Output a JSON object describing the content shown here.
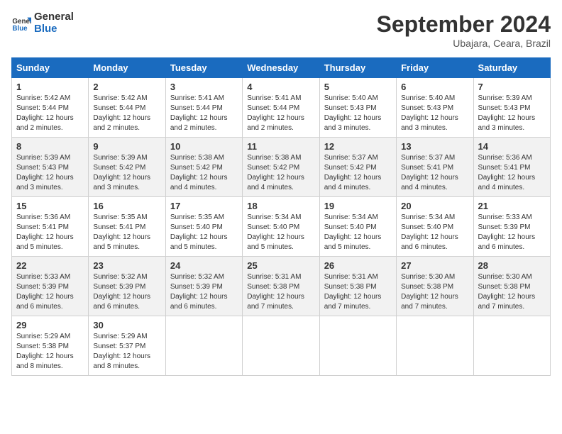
{
  "header": {
    "logo_line1": "General",
    "logo_line2": "Blue",
    "month_title": "September 2024",
    "location": "Ubajara, Ceara, Brazil"
  },
  "days_of_week": [
    "Sunday",
    "Monday",
    "Tuesday",
    "Wednesday",
    "Thursday",
    "Friday",
    "Saturday"
  ],
  "weeks": [
    [
      {
        "day": 1,
        "info": "Sunrise: 5:42 AM\nSunset: 5:44 PM\nDaylight: 12 hours\nand 2 minutes."
      },
      {
        "day": 2,
        "info": "Sunrise: 5:42 AM\nSunset: 5:44 PM\nDaylight: 12 hours\nand 2 minutes."
      },
      {
        "day": 3,
        "info": "Sunrise: 5:41 AM\nSunset: 5:44 PM\nDaylight: 12 hours\nand 2 minutes."
      },
      {
        "day": 4,
        "info": "Sunrise: 5:41 AM\nSunset: 5:44 PM\nDaylight: 12 hours\nand 2 minutes."
      },
      {
        "day": 5,
        "info": "Sunrise: 5:40 AM\nSunset: 5:43 PM\nDaylight: 12 hours\nand 3 minutes."
      },
      {
        "day": 6,
        "info": "Sunrise: 5:40 AM\nSunset: 5:43 PM\nDaylight: 12 hours\nand 3 minutes."
      },
      {
        "day": 7,
        "info": "Sunrise: 5:39 AM\nSunset: 5:43 PM\nDaylight: 12 hours\nand 3 minutes."
      }
    ],
    [
      {
        "day": 8,
        "info": "Sunrise: 5:39 AM\nSunset: 5:43 PM\nDaylight: 12 hours\nand 3 minutes."
      },
      {
        "day": 9,
        "info": "Sunrise: 5:39 AM\nSunset: 5:42 PM\nDaylight: 12 hours\nand 3 minutes."
      },
      {
        "day": 10,
        "info": "Sunrise: 5:38 AM\nSunset: 5:42 PM\nDaylight: 12 hours\nand 4 minutes."
      },
      {
        "day": 11,
        "info": "Sunrise: 5:38 AM\nSunset: 5:42 PM\nDaylight: 12 hours\nand 4 minutes."
      },
      {
        "day": 12,
        "info": "Sunrise: 5:37 AM\nSunset: 5:42 PM\nDaylight: 12 hours\nand 4 minutes."
      },
      {
        "day": 13,
        "info": "Sunrise: 5:37 AM\nSunset: 5:41 PM\nDaylight: 12 hours\nand 4 minutes."
      },
      {
        "day": 14,
        "info": "Sunrise: 5:36 AM\nSunset: 5:41 PM\nDaylight: 12 hours\nand 4 minutes."
      }
    ],
    [
      {
        "day": 15,
        "info": "Sunrise: 5:36 AM\nSunset: 5:41 PM\nDaylight: 12 hours\nand 5 minutes."
      },
      {
        "day": 16,
        "info": "Sunrise: 5:35 AM\nSunset: 5:41 PM\nDaylight: 12 hours\nand 5 minutes."
      },
      {
        "day": 17,
        "info": "Sunrise: 5:35 AM\nSunset: 5:40 PM\nDaylight: 12 hours\nand 5 minutes."
      },
      {
        "day": 18,
        "info": "Sunrise: 5:34 AM\nSunset: 5:40 PM\nDaylight: 12 hours\nand 5 minutes."
      },
      {
        "day": 19,
        "info": "Sunrise: 5:34 AM\nSunset: 5:40 PM\nDaylight: 12 hours\nand 5 minutes."
      },
      {
        "day": 20,
        "info": "Sunrise: 5:34 AM\nSunset: 5:40 PM\nDaylight: 12 hours\nand 6 minutes."
      },
      {
        "day": 21,
        "info": "Sunrise: 5:33 AM\nSunset: 5:39 PM\nDaylight: 12 hours\nand 6 minutes."
      }
    ],
    [
      {
        "day": 22,
        "info": "Sunrise: 5:33 AM\nSunset: 5:39 PM\nDaylight: 12 hours\nand 6 minutes."
      },
      {
        "day": 23,
        "info": "Sunrise: 5:32 AM\nSunset: 5:39 PM\nDaylight: 12 hours\nand 6 minutes."
      },
      {
        "day": 24,
        "info": "Sunrise: 5:32 AM\nSunset: 5:39 PM\nDaylight: 12 hours\nand 6 minutes."
      },
      {
        "day": 25,
        "info": "Sunrise: 5:31 AM\nSunset: 5:38 PM\nDaylight: 12 hours\nand 7 minutes."
      },
      {
        "day": 26,
        "info": "Sunrise: 5:31 AM\nSunset: 5:38 PM\nDaylight: 12 hours\nand 7 minutes."
      },
      {
        "day": 27,
        "info": "Sunrise: 5:30 AM\nSunset: 5:38 PM\nDaylight: 12 hours\nand 7 minutes."
      },
      {
        "day": 28,
        "info": "Sunrise: 5:30 AM\nSunset: 5:38 PM\nDaylight: 12 hours\nand 7 minutes."
      }
    ],
    [
      {
        "day": 29,
        "info": "Sunrise: 5:29 AM\nSunset: 5:38 PM\nDaylight: 12 hours\nand 8 minutes."
      },
      {
        "day": 30,
        "info": "Sunrise: 5:29 AM\nSunset: 5:37 PM\nDaylight: 12 hours\nand 8 minutes."
      },
      null,
      null,
      null,
      null,
      null
    ]
  ]
}
